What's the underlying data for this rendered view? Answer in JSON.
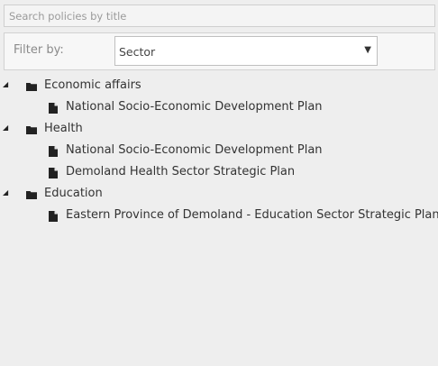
{
  "search": {
    "placeholder": "Search policies by title",
    "value": ""
  },
  "filter": {
    "label": "Filter by:",
    "selected": "Sector",
    "caret": "▼"
  },
  "tree": {
    "toggle_glyph": "◢",
    "groups": [
      {
        "label": "Economic affairs",
        "expanded": true,
        "items": [
          {
            "label": "National Socio-Economic Development Plan"
          }
        ]
      },
      {
        "label": "Health",
        "expanded": true,
        "items": [
          {
            "label": "National Socio-Economic Development Plan"
          },
          {
            "label": "Demoland Health Sector Strategic Plan"
          }
        ]
      },
      {
        "label": "Education",
        "expanded": true,
        "items": [
          {
            "label": "Eastern Province of Demoland - Education Sector Strategic Plan"
          }
        ]
      }
    ]
  },
  "colors": {
    "background": "#eeeeee",
    "text": "#333333",
    "icon": "#222222"
  }
}
